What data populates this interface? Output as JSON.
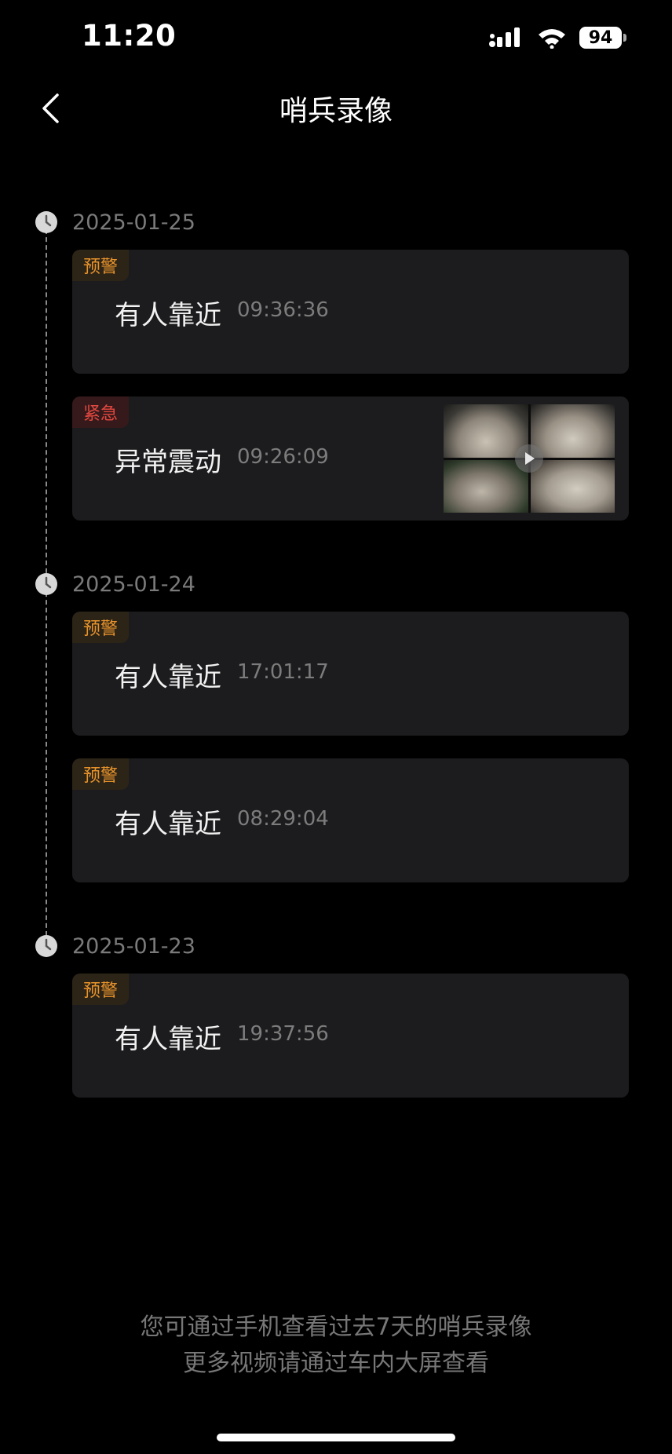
{
  "status_bar": {
    "time": "11:20",
    "battery": "94"
  },
  "nav": {
    "title": "哨兵录像"
  },
  "groups": [
    {
      "date": "2025-01-25",
      "events": [
        {
          "badge": "预警",
          "badge_type": "warning",
          "title": "有人靠近",
          "time": "09:36:36",
          "has_thumbnail": false
        },
        {
          "badge": "紧急",
          "badge_type": "urgent",
          "title": "异常震动",
          "time": "09:26:09",
          "has_thumbnail": true
        }
      ]
    },
    {
      "date": "2025-01-24",
      "events": [
        {
          "badge": "预警",
          "badge_type": "warning",
          "title": "有人靠近",
          "time": "17:01:17",
          "has_thumbnail": false
        },
        {
          "badge": "预警",
          "badge_type": "warning",
          "title": "有人靠近",
          "time": "08:29:04",
          "has_thumbnail": false
        }
      ]
    },
    {
      "date": "2025-01-23",
      "events": [
        {
          "badge": "预警",
          "badge_type": "warning",
          "title": "有人靠近",
          "time": "19:37:56",
          "has_thumbnail": false
        }
      ]
    }
  ],
  "footer": {
    "line1": "您可通过手机查看过去7天的哨兵录像",
    "line2": "更多视频请通过车内大屏查看"
  },
  "colors": {
    "warning": "#e8932a",
    "urgent": "#e0483f",
    "card_bg": "#1c1c1e"
  }
}
